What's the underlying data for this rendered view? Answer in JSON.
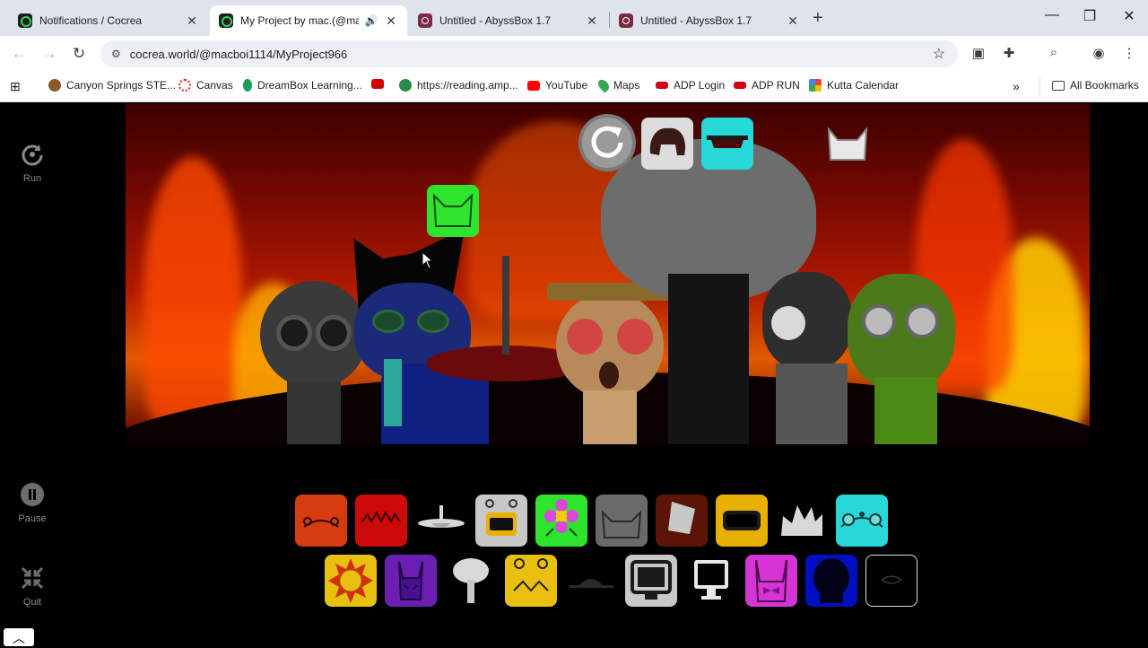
{
  "browser": {
    "tabs": [
      {
        "title": "Notifications / Cocrea",
        "favicon": "cocrea-favicon",
        "active": false
      },
      {
        "title": "My Project by mac.(@macb",
        "favicon": "cocrea-favicon",
        "active": true
      },
      {
        "title": "Untitled - AbyssBox 1.7",
        "favicon": "abyssbox-favicon",
        "active": false
      },
      {
        "title": "Untitled - AbyssBox 1.7",
        "favicon": "abyssbox-favicon",
        "active": false
      }
    ],
    "url": "cocrea.world/@macboi1114/MyProject966",
    "bookmarks": [
      {
        "label": "Canyon Springs STE...",
        "color": "#8b5a2b"
      },
      {
        "label": "Canvas",
        "color": "#e2231a"
      },
      {
        "label": "DreamBox Learning...",
        "color": "#1a9e5a"
      },
      {
        "label": "",
        "color": "#d00000"
      },
      {
        "label": "https://reading.amp...",
        "color": "#2a8a4a"
      },
      {
        "label": "YouTube",
        "color": "#ff0000"
      },
      {
        "label": "Maps",
        "color": "#34a853"
      },
      {
        "label": "ADP Login",
        "color": "#d0021b"
      },
      {
        "label": "ADP RUN",
        "color": "#d0021b"
      },
      {
        "label": "Kutta Calendar",
        "color": "#4285f4"
      }
    ],
    "all_bookmarks_label": "All Bookmarks"
  },
  "sidebar": {
    "run_label": "Run",
    "pause_label": "Pause",
    "quit_label": "Quit"
  },
  "game": {
    "top_controls": [
      "reset-icon",
      "hair-icon",
      "hat-icon"
    ],
    "icon_rows": [
      [
        "orange-antenna-icon",
        "red-spiky-icon",
        "saucer-icon",
        "robot-antenna-icon",
        "green-flower-icon",
        "gray-horns-icon",
        "brown-bucket-icon",
        "yellow-visor-icon",
        "white-crown-icon",
        "cyan-bear-icon"
      ],
      [
        "yellow-sun-icon",
        "purple-horns-icon",
        "gray-balloon-icon",
        "yellow-antenna-icon",
        "dark-hat-icon",
        "computer-monitor-icon",
        "small-monitor-icon",
        "pink-bow-icon",
        "blue-hood-icon",
        "dark-eye-icon"
      ]
    ],
    "colors": {
      "orange": "#d63c10",
      "red": "#cc0a0a",
      "green": "#2ee52e",
      "cyan": "#27d8d8",
      "yellow": "#e8c010",
      "purple": "#6a1fb0",
      "pink": "#d535d5",
      "blue": "#0010c0"
    }
  }
}
